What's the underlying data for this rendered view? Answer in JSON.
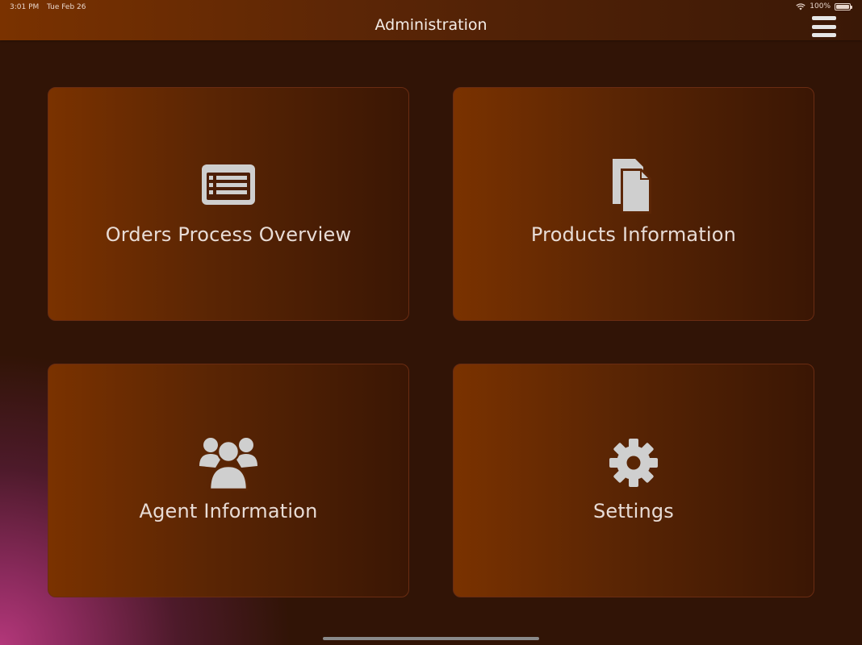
{
  "status_bar": {
    "time": "3:01 PM",
    "date": "Tue Feb 26",
    "battery": "100%"
  },
  "nav": {
    "title": "Administration",
    "menu_icon": "hamburger-menu-icon"
  },
  "tiles": [
    {
      "label": "Orders Process Overview",
      "icon": "list-icon"
    },
    {
      "label": "Products Information",
      "icon": "documents-icon"
    },
    {
      "label": "Agent Information",
      "icon": "users-icon"
    },
    {
      "label": "Settings",
      "icon": "gear-icon"
    }
  ],
  "colors": {
    "accent": "#7a3200",
    "background": "#311406",
    "icon": "#cfcfcf"
  }
}
